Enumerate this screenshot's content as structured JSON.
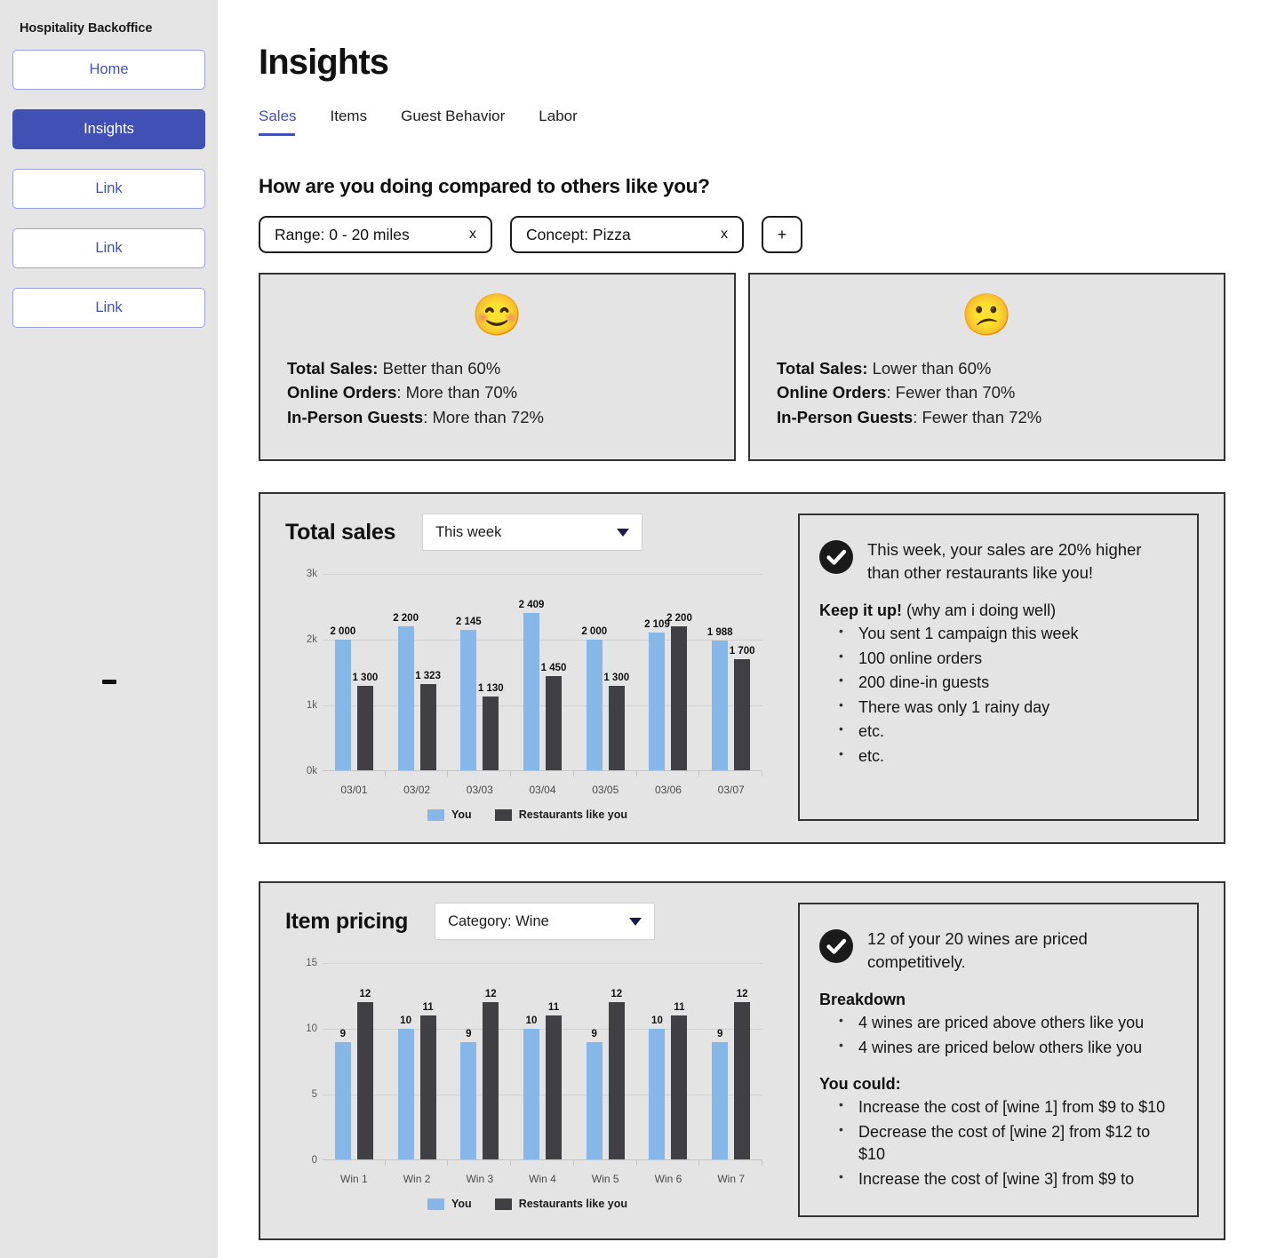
{
  "sidebar": {
    "brand": "Hospitality Backoffice",
    "items": [
      {
        "label": "Home",
        "active": false
      },
      {
        "label": "Insights",
        "active": true
      },
      {
        "label": "Link",
        "active": false
      },
      {
        "label": "Link",
        "active": false
      },
      {
        "label": "Link",
        "active": false
      }
    ],
    "dash": "-"
  },
  "header": {
    "title": "Insights"
  },
  "tabs": [
    {
      "label": "Sales",
      "active": true
    },
    {
      "label": "Items",
      "active": false
    },
    {
      "label": "Guest Behavior",
      "active": false
    },
    {
      "label": "Labor",
      "active": false
    }
  ],
  "compare_section": {
    "heading": "How are you doing compared to others like you?",
    "chips": [
      {
        "label": "Range: 0 - 20 miles",
        "close": "x"
      },
      {
        "label": "Concept: Pizza",
        "close": "x"
      }
    ],
    "add_chip": "+",
    "cards": [
      {
        "emoji": "😊",
        "emoji_name": "smiling-face-emoji",
        "lines": [
          {
            "label": "Total Sales:",
            "value": " Better than 60%"
          },
          {
            "label": "Online Orders",
            "value": ": More than 70%"
          },
          {
            "label": "In-Person Guests",
            "value": ": More than 72%"
          }
        ]
      },
      {
        "emoji": "😕",
        "emoji_name": "frowning-face-emoji",
        "lines": [
          {
            "label": "Total Sales:",
            "value": " Lower than 60%"
          },
          {
            "label": "Online Orders",
            "value": ": Fewer than 70%"
          },
          {
            "label": "In-Person Guests",
            "value": ": Fewer than 72%"
          }
        ]
      }
    ]
  },
  "total_sales_panel": {
    "title": "Total sales",
    "select_value": "This week",
    "insight": {
      "icon": "check-circle-icon",
      "lead": "This week, your sales are 20% higher than other restaurants like you!",
      "heading_bold": "Keep it up!",
      "heading_normal": " (why am i doing well)",
      "bullets": [
        "You sent 1 campaign this week",
        "100 online orders",
        "200 dine-in guests",
        "There was only 1 rainy day",
        "etc.",
        "etc."
      ]
    }
  },
  "item_pricing_panel": {
    "title": "Item pricing",
    "select_value": "Category: Wine",
    "insight": {
      "icon": "check-circle-icon",
      "lead": "12 of your 20 wines are priced competitively.",
      "breakdown_heading": "Breakdown",
      "breakdown_bullets": [
        "4 wines are priced above others like you",
        "4 wines are priced below others like you"
      ],
      "could_heading": "You could:",
      "could_bullets": [
        "Increase the cost of [wine 1] from $9 to $10",
        "Decrease the cost of [wine 2] from $12 to $10",
        "Increase the cost of [wine 3] from $9 to"
      ]
    }
  },
  "chart_data": [
    {
      "id": "total-sales-chart",
      "type": "bar",
      "title": "Total sales",
      "xlabel": "",
      "ylabel": "",
      "ylim": [
        0,
        3000
      ],
      "yticks": [
        0,
        1000,
        2000,
        3000
      ],
      "ytick_labels": [
        "0k",
        "1k",
        "2k",
        "3k"
      ],
      "grid": true,
      "legend_position": "bottom",
      "categories": [
        "03/01",
        "03/02",
        "03/03",
        "03/04",
        "03/05",
        "03/06",
        "03/07"
      ],
      "series": [
        {
          "name": "You",
          "color": "#85b7e8",
          "values": [
            2000,
            2200,
            2145,
            2409,
            2000,
            2109,
            1988
          ],
          "labels": [
            "2 000",
            "2 200",
            "2 145",
            "2 409",
            "2 000",
            "2 109",
            "1 988"
          ]
        },
        {
          "name": "Restaurants like you",
          "color": "#3f3f44",
          "values": [
            1300,
            1323,
            1130,
            1450,
            1300,
            2200,
            1700
          ],
          "labels": [
            "1 300",
            "1 323",
            "1 130",
            "1 450",
            "1 300",
            "2 200",
            "1 700"
          ]
        }
      ]
    },
    {
      "id": "item-pricing-chart",
      "type": "bar",
      "title": "Item pricing",
      "xlabel": "",
      "ylabel": "",
      "ylim": [
        0,
        15
      ],
      "yticks": [
        0,
        5,
        10,
        15
      ],
      "ytick_labels": [
        "0",
        "5",
        "10",
        "15"
      ],
      "grid": true,
      "legend_position": "bottom",
      "categories": [
        "Win 1",
        "Win 2",
        "Win 3",
        "Win 4",
        "Win 5",
        "Win 6",
        "Win 7"
      ],
      "series": [
        {
          "name": "You",
          "color": "#85b7e8",
          "values": [
            9,
            10,
            9,
            10,
            9,
            10,
            9
          ],
          "labels": [
            "9",
            "10",
            "9",
            "10",
            "9",
            "10",
            "9"
          ]
        },
        {
          "name": "Restaurants like you",
          "color": "#3f3f44",
          "values": [
            12,
            11,
            12,
            11,
            12,
            11,
            12
          ],
          "labels": [
            "12",
            "11",
            "12",
            "11",
            "12",
            "11",
            "12"
          ]
        }
      ]
    }
  ],
  "colors": {
    "accent": "#4050b5",
    "panel_bg": "#e4e4e4",
    "sidebar_bg": "#e5e5e5",
    "series_you": "#85b7e8",
    "series_them": "#3f3f44"
  }
}
